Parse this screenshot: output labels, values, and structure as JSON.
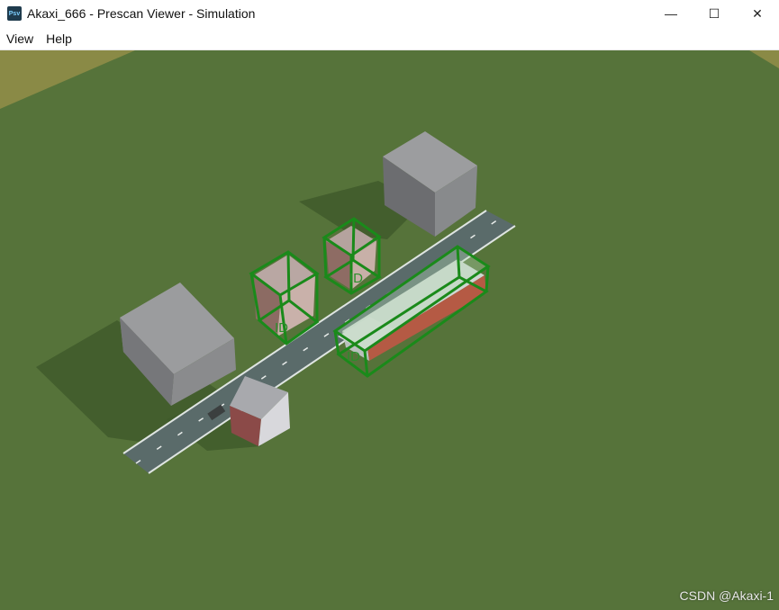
{
  "window": {
    "app_icon_text": "Psv",
    "title": "Akaxi_666 - Prescan Viewer - Simulation",
    "minimize": "—",
    "maximize": "☐",
    "close": "✕"
  },
  "menu": [
    {
      "label": "View"
    },
    {
      "label": "Help"
    }
  ],
  "scene": {
    "ground_color": "#56733a",
    "bbox_color": "#1a8a1a",
    "labels": [
      "ID",
      "ID",
      "ID"
    ]
  },
  "watermark": "CSDN @Akaxi-1"
}
